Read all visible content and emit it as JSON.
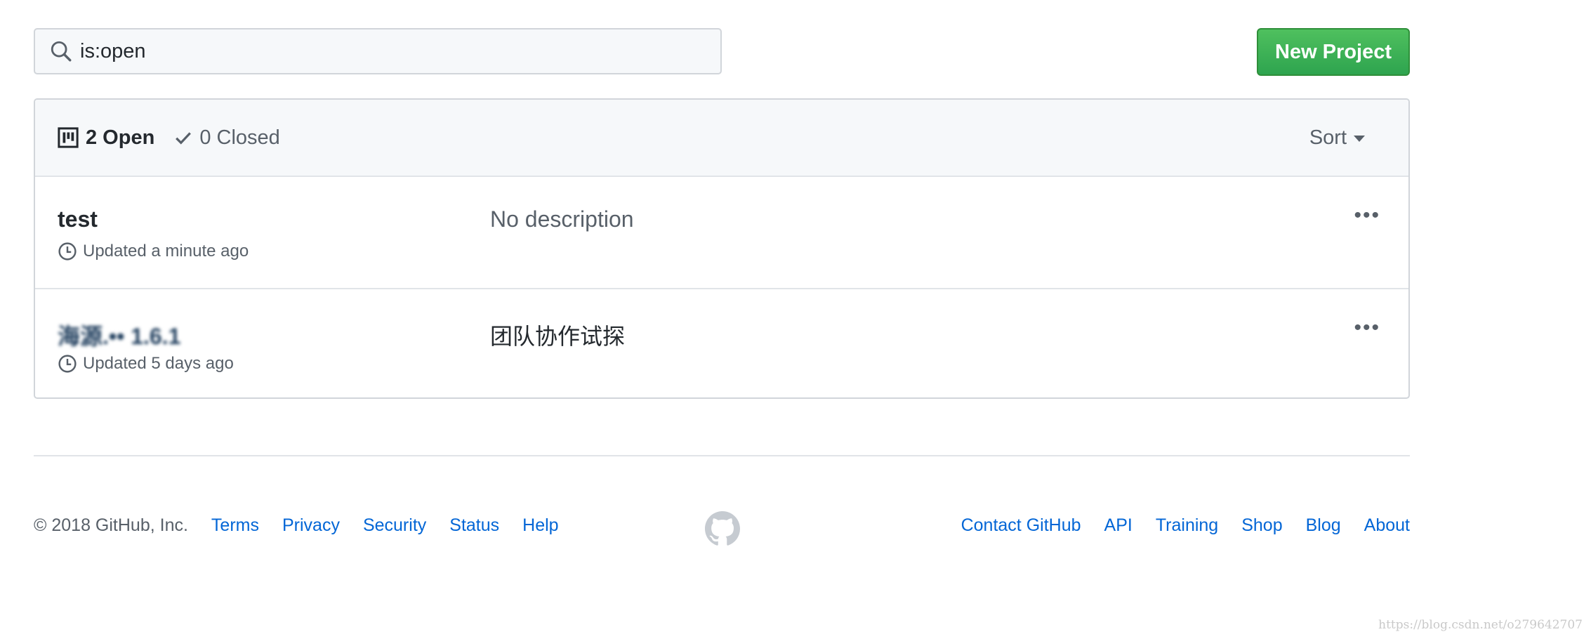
{
  "search": {
    "value": "is:open",
    "icon": "search-icon"
  },
  "toolbar": {
    "new_project_label": "New Project"
  },
  "states": {
    "open_label": "2 Open",
    "closed_label": "0 Closed",
    "open_icon": "project-icon",
    "closed_icon": "check-icon"
  },
  "sort": {
    "label": "Sort"
  },
  "projects": [
    {
      "name": "test",
      "updated": "Updated a minute ago",
      "description": "No description"
    },
    {
      "name": "海源.••  1.6.1",
      "updated": "Updated 5 days ago",
      "description": "团队协作试探"
    }
  ],
  "footer": {
    "copyright": "© 2018 GitHub, Inc.",
    "left_links": [
      "Terms",
      "Privacy",
      "Security",
      "Status",
      "Help"
    ],
    "right_links": [
      "Contact GitHub",
      "API",
      "Training",
      "Shop",
      "Blog",
      "About"
    ],
    "logo_icon": "github-mark-icon"
  },
  "watermark": "https://blog.csdn.net/o279642707",
  "colors": {
    "accent_link": "#0366d6",
    "button_green": "#2ea44f",
    "muted": "#586069"
  }
}
